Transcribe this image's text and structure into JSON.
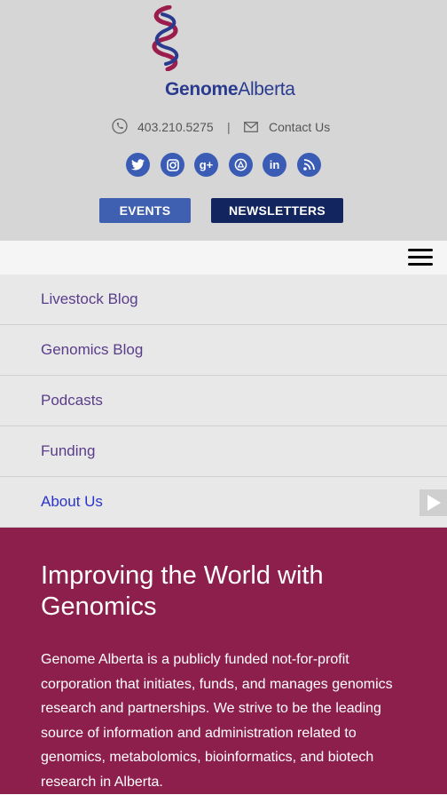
{
  "brand": {
    "name_bold": "Genome",
    "name_regular": "Alberta"
  },
  "contact": {
    "phone": "403.210.5275",
    "separator": "|",
    "contact_label": "Contact Us"
  },
  "social": [
    {
      "icon": "twitter-icon",
      "glyph": "t"
    },
    {
      "icon": "instagram-icon",
      "glyph": "◎"
    },
    {
      "icon": "google-plus-icon",
      "glyph": "g+"
    },
    {
      "icon": "flickr-icon",
      "glyph": "◍"
    },
    {
      "icon": "linkedin-icon",
      "glyph": "in"
    },
    {
      "icon": "rss-icon",
      "glyph": "◗"
    }
  ],
  "buttons": {
    "events": "EVENTS",
    "newsletters": "NEWSLETTERS"
  },
  "nav": {
    "items": [
      {
        "label": "Livestock Blog"
      },
      {
        "label": "Genomics Blog"
      },
      {
        "label": "Podcasts"
      },
      {
        "label": "Funding"
      },
      {
        "label": "About Us"
      }
    ]
  },
  "hero": {
    "title": "Improving the World with Genomics",
    "body": "Genome Alberta is a publicly funded not-for-profit corporation that initiates, funds, and manages genomics research and partnerships. We strive to be the leading source of information and administration related to genomics, metabolomics, bioinformatics, and biotech research in Alberta."
  },
  "colors": {
    "header_bg": "#d6d6d6",
    "brand_blue": "#2a3b8f",
    "hero_bg": "#8c1f4c",
    "nav_text": "#5a3d8a",
    "active_link": "#2b35c8"
  }
}
